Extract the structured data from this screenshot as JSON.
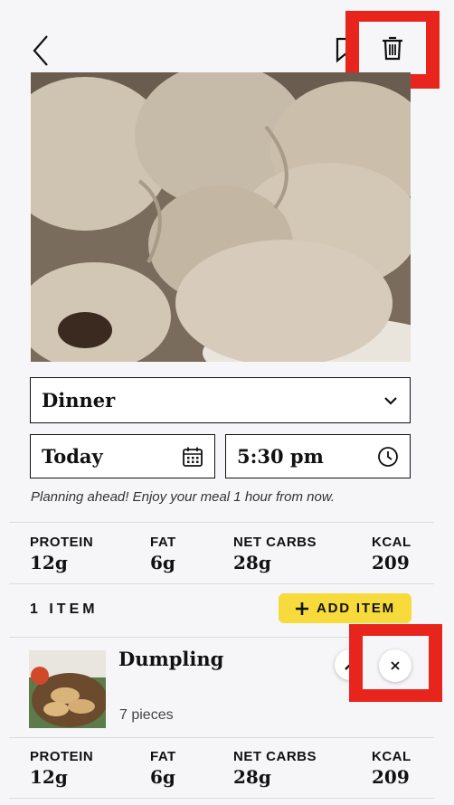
{
  "header": {
    "back_icon": "chevron-left-icon",
    "bookmark_icon": "bookmark-icon",
    "delete_icon": "trash-icon"
  },
  "meal_select": {
    "value": "Dinner",
    "icon": "chevron-down-icon"
  },
  "date_field": {
    "value": "Today",
    "icon": "calendar-icon"
  },
  "time_field": {
    "value": "5:30 pm",
    "icon": "clock-icon"
  },
  "hint": "Planning ahead! Enjoy your meal 1 hour from now.",
  "totals": {
    "protein_label": "PROTEIN",
    "protein": "12g",
    "fat_label": "FAT",
    "fat": "6g",
    "carbs_label": "NET CARBS",
    "carbs": "28g",
    "kcal_label": "KCAL",
    "kcal": "209"
  },
  "items_header": {
    "count_label": "1 ITEM",
    "add_label": "ADD ITEM"
  },
  "items": [
    {
      "name": "Dumpling",
      "quantity": "7 pieces",
      "protein_label": "PROTEIN",
      "protein": "12g",
      "fat_label": "FAT",
      "fat": "6g",
      "carbs_label": "NET CARBS",
      "carbs": "28g",
      "kcal_label": "KCAL",
      "kcal": "209"
    }
  ],
  "colors": {
    "accent_yellow": "#f7da3c",
    "highlight_red": "#e8251c"
  }
}
